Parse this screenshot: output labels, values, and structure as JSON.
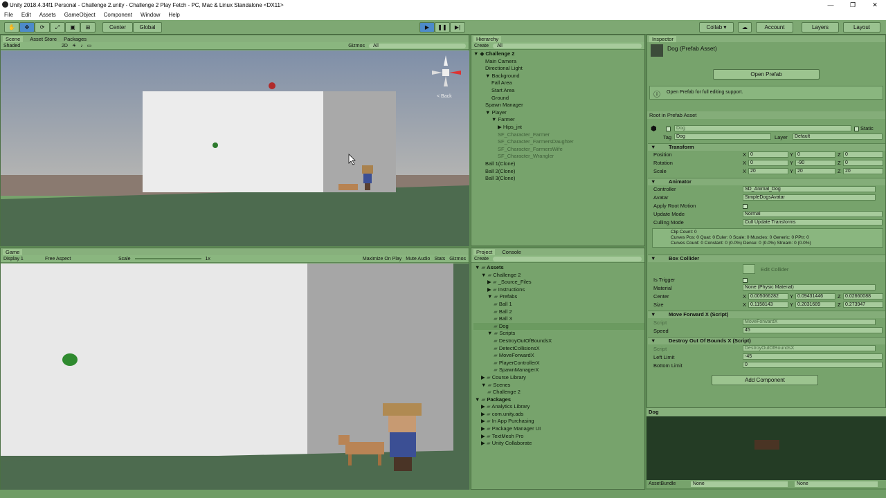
{
  "window": {
    "title": "Unity 2018.4.34f1 Personal - Challenge 2.unity - Challenge 2 Play Fetch - PC, Mac & Linux Standalone <DX11>",
    "minimize": "—",
    "maximize": "❐",
    "close": "✕"
  },
  "menu": [
    "File",
    "Edit",
    "Assets",
    "GameObject",
    "Component",
    "Window",
    "Help"
  ],
  "toolbar": {
    "pivot": "Center",
    "space": "Global",
    "play": "▶",
    "pause": "❚❚",
    "step": "▶|",
    "collab": "Collab ▾",
    "cloud": "☁",
    "account": "Account",
    "layers": "Layers",
    "layout": "Layout"
  },
  "scene": {
    "tabs": [
      "Scene",
      "Asset Store",
      "Packages"
    ],
    "shading": "Shaded",
    "mode2d": "2D",
    "gizmos": "Gizmos",
    "search": "All",
    "back_label": "< Back"
  },
  "game": {
    "tab": "Game",
    "display": "Display 1",
    "aspect": "Free Aspect",
    "scale_label": "Scale",
    "scale_value": "1x",
    "buttons": [
      "Maximize On Play",
      "Mute Audio",
      "Stats",
      "Gizmos"
    ]
  },
  "hierarchy": {
    "tab": "Hierarchy",
    "create": "Create",
    "search": "All",
    "scene": "Challenge 2",
    "items": [
      {
        "label": "Main Camera",
        "d": 1
      },
      {
        "label": "Directional Light",
        "d": 1
      },
      {
        "label": "Background",
        "d": 1,
        "open": true
      },
      {
        "label": "Fall Area",
        "d": 2
      },
      {
        "label": "Start Area",
        "d": 2
      },
      {
        "label": "Ground",
        "d": 2
      },
      {
        "label": "Spawn Manager",
        "d": 1
      },
      {
        "label": "Player",
        "d": 1,
        "open": true
      },
      {
        "label": "Farmer",
        "d": 2,
        "open": true
      },
      {
        "label": "Hips_jnt",
        "d": 3,
        "closed": true
      },
      {
        "label": "SF_Character_Farmer",
        "d": 3,
        "dim": true
      },
      {
        "label": "SF_Character_FarmersDaughter",
        "d": 3,
        "dim": true
      },
      {
        "label": "SF_Character_FarmersWife",
        "d": 3,
        "dim": true
      },
      {
        "label": "SF_Character_Wrangler",
        "d": 3,
        "dim": true
      },
      {
        "label": "Ball 1(Clone)",
        "d": 1
      },
      {
        "label": "Ball 2(Clone)",
        "d": 1
      },
      {
        "label": "Ball 3(Clone)",
        "d": 1
      }
    ]
  },
  "project": {
    "tabs": [
      "Project",
      "Console"
    ],
    "create": "Create",
    "items": [
      {
        "label": "Assets",
        "d": 0,
        "bold": true,
        "open": true
      },
      {
        "label": "Challenge 2",
        "d": 1,
        "open": true
      },
      {
        "label": "_Source_Files",
        "d": 2,
        "closed": true
      },
      {
        "label": "Instructions",
        "d": 2,
        "closed": true
      },
      {
        "label": "Prefabs",
        "d": 2,
        "open": true
      },
      {
        "label": "Ball 1",
        "d": 3
      },
      {
        "label": "Ball 2",
        "d": 3
      },
      {
        "label": "Ball 3",
        "d": 3
      },
      {
        "label": "Dog",
        "d": 3,
        "sel": true
      },
      {
        "label": "Scripts",
        "d": 2,
        "open": true
      },
      {
        "label": "DestroyOutOfBoundsX",
        "d": 3
      },
      {
        "label": "DetectCollisionsX",
        "d": 3
      },
      {
        "label": "MoveForwardX",
        "d": 3
      },
      {
        "label": "PlayerControllerX",
        "d": 3
      },
      {
        "label": "SpawnManagerX",
        "d": 3
      },
      {
        "label": "Course Library",
        "d": 1,
        "closed": true
      },
      {
        "label": "Scenes",
        "d": 1,
        "open": true
      },
      {
        "label": "Challenge 2",
        "d": 2
      },
      {
        "label": "Packages",
        "d": 0,
        "bold": true,
        "open": true
      },
      {
        "label": "Analytics Library",
        "d": 1,
        "closed": true
      },
      {
        "label": "com.unity.ads",
        "d": 1,
        "closed": true
      },
      {
        "label": "In App Purchasing",
        "d": 1,
        "closed": true
      },
      {
        "label": "Package Manager UI",
        "d": 1,
        "closed": true
      },
      {
        "label": "TextMesh Pro",
        "d": 1,
        "closed": true
      },
      {
        "label": "Unity Collaborate",
        "d": 1,
        "closed": true
      }
    ]
  },
  "inspector": {
    "tab": "Inspector",
    "asset_title": "Dog (Prefab Asset)",
    "open_prefab": "Open Prefab",
    "info": "Open Prefab for full editing support.",
    "root": "Root in Prefab Asset",
    "name": "Dog",
    "static": "Static",
    "tag_label": "Tag",
    "tag": "Dog",
    "layer_label": "Layer",
    "layer": "Default",
    "transform": {
      "title": "Transform",
      "rows": [
        {
          "label": "Position",
          "x": "0",
          "y": "0",
          "z": "0"
        },
        {
          "label": "Rotation",
          "x": "0",
          "y": "-90",
          "z": "0"
        },
        {
          "label": "Scale",
          "x": "20",
          "y": "20",
          "z": "20"
        }
      ]
    },
    "animator": {
      "title": "Animator",
      "controller_label": "Controller",
      "controller": "SD_Animal_Dog",
      "avatar_label": "Avatar",
      "avatar": "SimpleDogsAvatar",
      "root_motion": "Apply Root Motion",
      "update_label": "Update Mode",
      "update": "Normal",
      "culling_label": "Culling Mode",
      "culling": "Cull Update Transforms",
      "info": [
        "Clip Count: 0",
        "Curves Pos: 0 Quat: 0 Euler: 0 Scale: 0 Muscles: 0 Generic: 0 PPtr: 0",
        "Curves Count: 0 Constant: 0 (0.0%) Dense: 0 (0.0%) Stream: 0 (0.0%)"
      ]
    },
    "box": {
      "title": "Box Collider",
      "edit": "Edit Collider",
      "trigger": "Is Trigger",
      "material_label": "Material",
      "material": "None (Physic Material)",
      "center_label": "Center",
      "center": {
        "x": "0.005066282",
        "y": "0.09431446",
        "z": "0.02660088"
      },
      "size_label": "Size",
      "size": {
        "x": "0.1158143",
        "y": "0.2031689",
        "z": "0.273947"
      }
    },
    "move": {
      "title": "Move Forward X (Script)",
      "script_label": "Script",
      "script": "MoveForwardX",
      "speed_label": "Speed",
      "speed": "45"
    },
    "destroy": {
      "title": "Destroy Out Of Bounds X (Script)",
      "script_label": "Script",
      "script": "DestroyOutOfBoundsX",
      "left_label": "Left Limit",
      "left": "-45",
      "bottom_label": "Bottom Limit",
      "bottom": "0"
    },
    "add": "Add Component",
    "preview_title": "Dog",
    "assetbundle": "AssetBundle",
    "none1": "None",
    "none2": "None"
  },
  "axis": {
    "x": "X",
    "y": "Y",
    "z": "Z"
  }
}
